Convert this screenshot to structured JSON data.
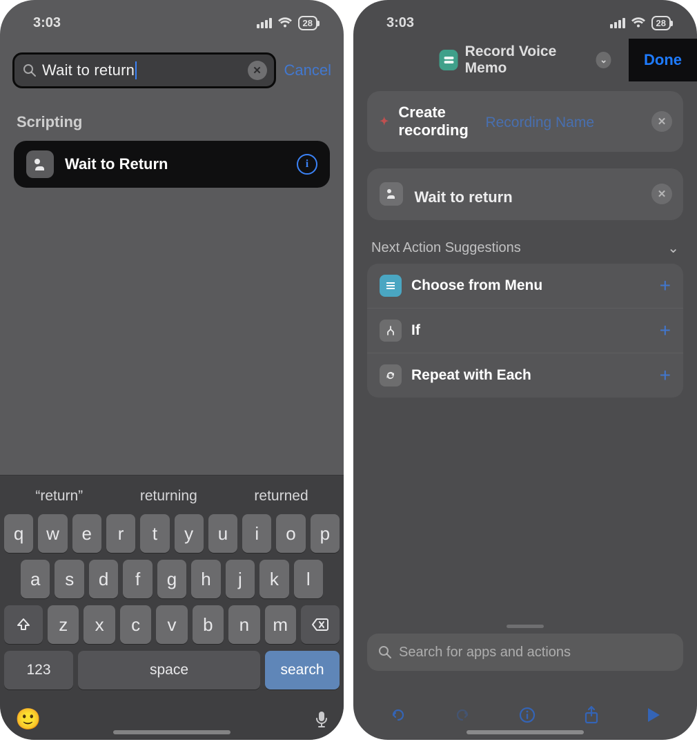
{
  "left": {
    "status": {
      "time": "3:03",
      "battery": "28"
    },
    "search": {
      "value": "Wait to return",
      "cancel": "Cancel"
    },
    "section_label": "Scripting",
    "result": {
      "title": "Wait to Return"
    },
    "keyboard": {
      "suggestions": [
        "“return”",
        "returning",
        "returned"
      ],
      "row1": [
        "q",
        "w",
        "e",
        "r",
        "t",
        "y",
        "u",
        "i",
        "o",
        "p"
      ],
      "row2": [
        "a",
        "s",
        "d",
        "f",
        "g",
        "h",
        "j",
        "k",
        "l"
      ],
      "row3": [
        "z",
        "x",
        "c",
        "v",
        "b",
        "n",
        "m"
      ],
      "num": "123",
      "space": "space",
      "search": "search"
    }
  },
  "right": {
    "status": {
      "time": "3:03",
      "battery": "28"
    },
    "header": {
      "title": "Record Voice Memo",
      "done": "Done"
    },
    "action1": {
      "label": "Create recording",
      "token": "Recording Name"
    },
    "action2": {
      "label": "Wait to return"
    },
    "suggestions_header": "Next Action Suggestions",
    "suggestions": [
      {
        "label": "Choose from Menu"
      },
      {
        "label": "If"
      },
      {
        "label": "Repeat with Each"
      }
    ],
    "bottom_search_placeholder": "Search for apps and actions"
  }
}
